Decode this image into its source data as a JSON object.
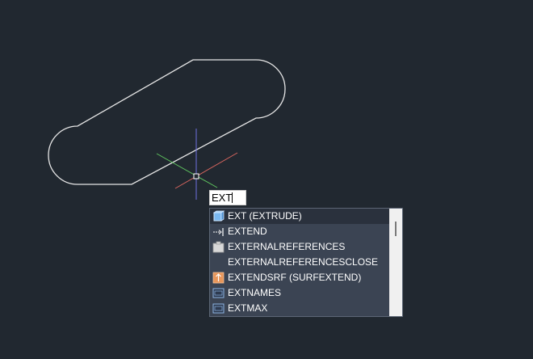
{
  "command_line": {
    "typed_text": "EXT"
  },
  "autocomplete": {
    "selected_index": 0,
    "items": [
      {
        "label": "EXT (EXTRUDE)",
        "icon": "extrude-icon"
      },
      {
        "label": "EXTEND",
        "icon": "extend-icon"
      },
      {
        "label": "EXTERNALREFERENCES",
        "icon": "external-references-icon"
      },
      {
        "label": "EXTERNALREFERENCESCLOSE",
        "icon": ""
      },
      {
        "label": "EXTENDSRF (SURFEXTEND)",
        "icon": "surface-extend-icon"
      },
      {
        "label": "EXTNAMES",
        "icon": "extnames-icon"
      },
      {
        "label": "EXTMAX",
        "icon": "extmax-icon"
      }
    ]
  },
  "colors": {
    "background": "#212830",
    "geometry": "#e6e6e6",
    "x_axis": "#d9665f",
    "y_axis": "#6f6fe0",
    "z_axis": "#5fc45f",
    "list_background": "#3b4453",
    "list_selected": "#2a313d"
  }
}
